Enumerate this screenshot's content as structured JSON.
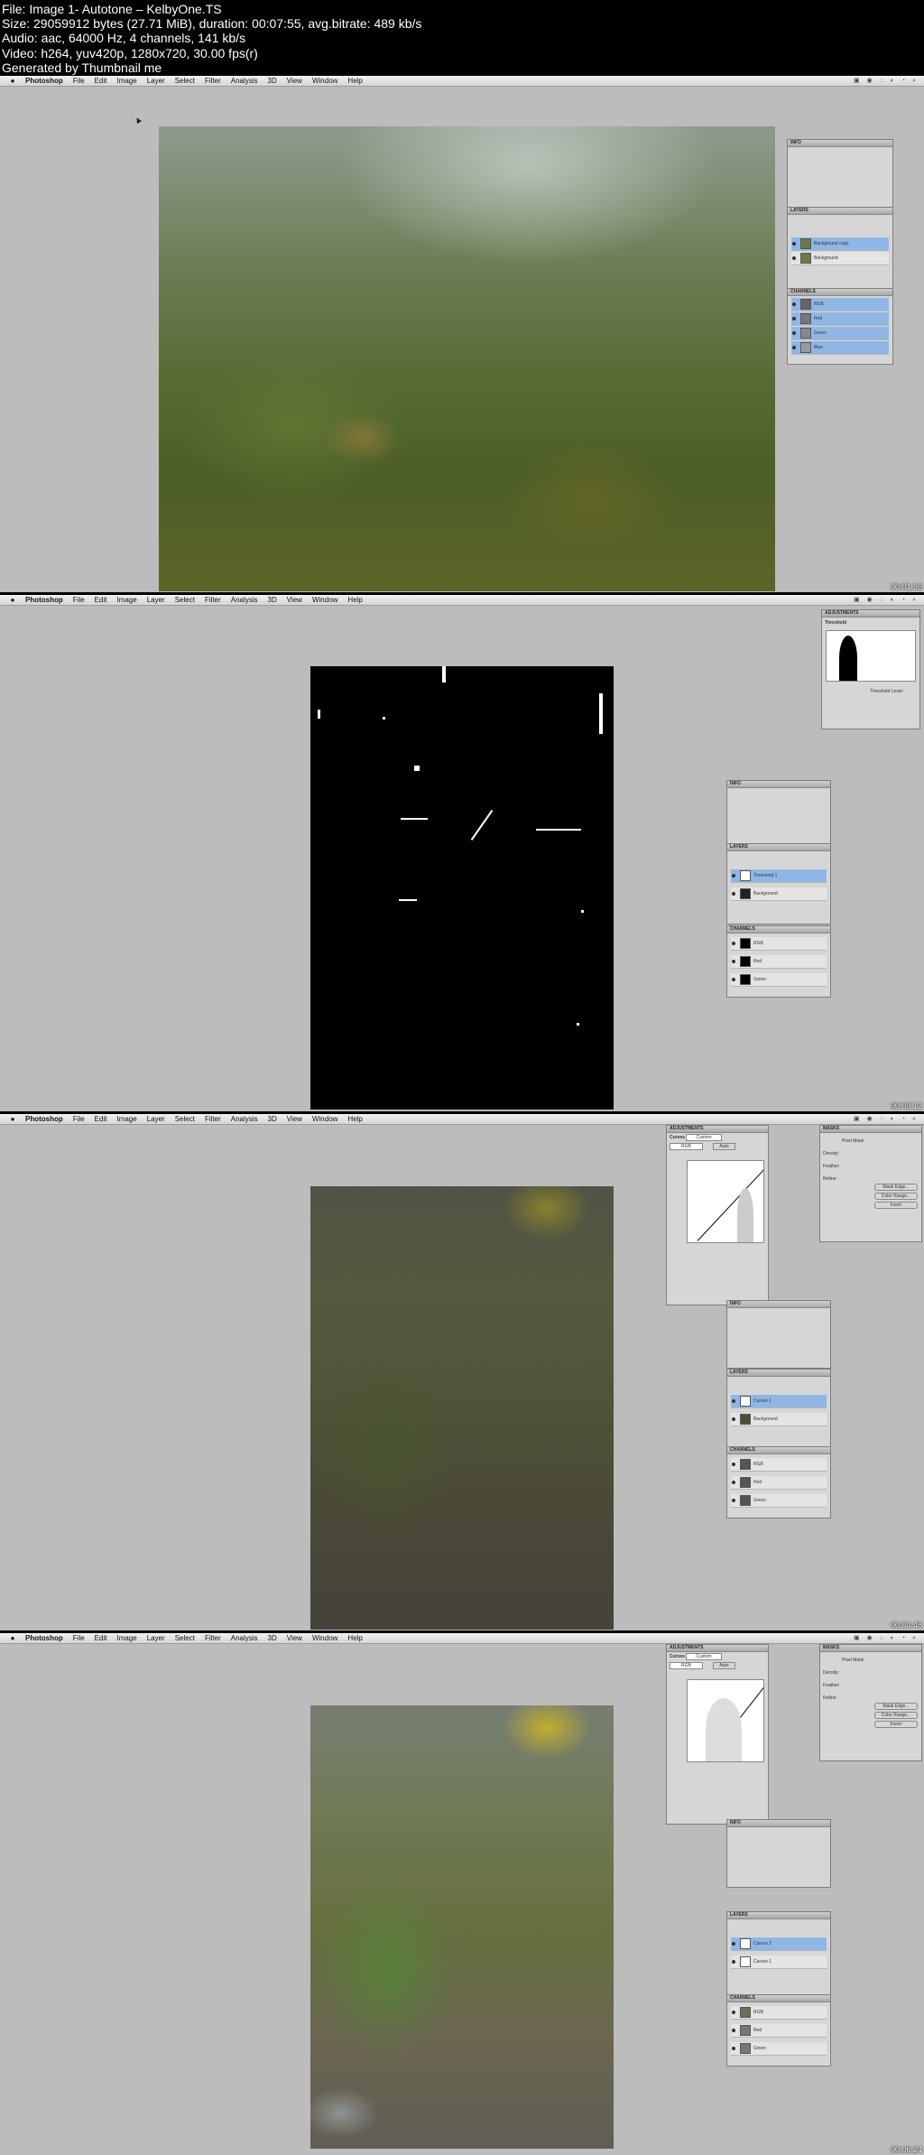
{
  "header": {
    "lines": [
      "File: Image 1- Autotone – KelbyOne.TS",
      "Size: 29059912 bytes (27.71 MiB), duration: 00:07:55, avg.bitrate: 489 kb/s",
      "Audio: aac, 64000 Hz, 4 channels, 141 kb/s",
      "Video: h264, yuv420p, 1280x720, 30.00 fps(r)",
      "Generated by Thumbnail me"
    ]
  },
  "menu": {
    "apple": "",
    "items": [
      "Photoshop",
      "File",
      "Edit",
      "Image",
      "Layer",
      "Select",
      "Filter",
      "Analysis",
      "3D",
      "View",
      "Window",
      "Help"
    ]
  },
  "frames": [
    {
      "timestamp": "00:01:36",
      "panels": {
        "layers_title": "LAYERS",
        "layers": [
          "Background copy",
          "Background"
        ],
        "channels_title": "CHANNELS",
        "channels": [
          "RGB",
          "Red",
          "Green",
          "Blue"
        ]
      }
    },
    {
      "timestamp": "00:03:12",
      "panels": {
        "adj_title": "ADJUSTMENTS",
        "adj_name": "Threshold",
        "adj_level_label": "Threshold Level:",
        "layers_title": "LAYERS",
        "layers": [
          "Threshold 1",
          "Background"
        ],
        "channels_title": "CHANNELS",
        "channels": [
          "RGB",
          "Red",
          "Green"
        ]
      }
    },
    {
      "timestamp": "00:04:48",
      "panels": {
        "adj_title": "ADJUSTMENTS",
        "adj_name": "Curves",
        "preset": "Custom",
        "channel": "RGB",
        "auto": "Auto",
        "masks_title": "MASKS",
        "mask_name": "Pixel Mask",
        "density": "Density:",
        "feather": "Feather:",
        "refine": "Refine:",
        "mask_edge": "Mask Edge...",
        "color_range": "Color Range...",
        "invert": "Invert",
        "layers_title": "LAYERS",
        "layers": [
          "Curves 1",
          "Background"
        ],
        "channels_title": "CHANNELS",
        "channels": [
          "RGB",
          "Red",
          "Green"
        ]
      }
    },
    {
      "timestamp": "00:06:24",
      "panels": {
        "adj_title": "ADJUSTMENTS",
        "adj_name": "Curves",
        "preset": "Custom",
        "channel": "RGB",
        "auto": "Auto",
        "masks_title": "MASKS",
        "mask_name": "Pixel Mask",
        "density": "Density:",
        "feather": "Feather:",
        "refine": "Refine:",
        "mask_edge": "Mask Edge...",
        "color_range": "Color Range...",
        "invert": "Invert",
        "layers_title": "LAYERS",
        "layers": [
          "Curves 2",
          "Curves 1"
        ],
        "channels_title": "CHANNELS",
        "channels": [
          "RGB",
          "Red",
          "Green"
        ]
      }
    }
  ]
}
